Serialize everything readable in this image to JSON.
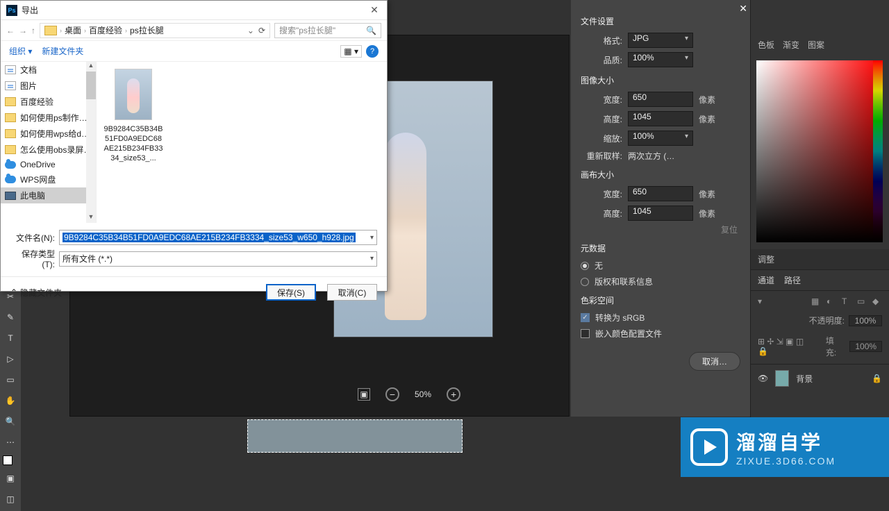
{
  "dialog": {
    "title": "导出",
    "breadcrumb": [
      "桌面",
      "百度经验",
      "ps拉长腿"
    ],
    "search_placeholder": "搜索\"ps拉长腿\"",
    "organize": "组织",
    "new_folder": "新建文件夹",
    "sidebar": [
      {
        "label": "文档",
        "icon": "doc"
      },
      {
        "label": "图片",
        "icon": "doc"
      },
      {
        "label": "百度经验",
        "icon": "folder"
      },
      {
        "label": "如何使用ps制作…",
        "icon": "folder"
      },
      {
        "label": "如何使用wps给d…",
        "icon": "folder"
      },
      {
        "label": "怎么使用obs录屏…",
        "icon": "folder"
      },
      {
        "label": "OneDrive",
        "icon": "cloud"
      },
      {
        "label": "WPS网盘",
        "icon": "cloud"
      },
      {
        "label": "此电脑",
        "icon": "pc",
        "selected": true
      }
    ],
    "file_thumb_name": "9B9284C35B34B51FD0A9EDC68AE215B234FB3334_size53_...",
    "filename_label": "文件名(N):",
    "filename_value": "9B9284C35B34B51FD0A9EDC68AE215B234FB3334_size53_w650_h928.jpg",
    "filetype_label": "保存类型(T):",
    "filetype_value": "所有文件 (*.*)",
    "hide_folders": "隐藏文件夹",
    "save_btn": "保存(S)",
    "cancel_btn": "取消(C)"
  },
  "export": {
    "file_settings": "文件设置",
    "format_label": "格式:",
    "format_value": "JPG",
    "quality_label": "品质:",
    "quality_value": "100%",
    "image_size": "图像大小",
    "width_label": "宽度:",
    "width_value": "650",
    "height_label": "高度:",
    "height_value": "1045",
    "scale_label": "缩放:",
    "scale_value": "100%",
    "resample_label": "重新取样:",
    "resample_value": "两次立方 (…",
    "unit": "像素",
    "canvas_size": "画布大小",
    "c_width": "650",
    "c_height": "1045",
    "reset": "复位",
    "metadata": "元数据",
    "meta_none": "无",
    "meta_copyright": "版权和联系信息",
    "colorspace": "色彩空间",
    "convert_srgb": "转换为 sRGB",
    "embed_profile": "嵌入颜色配置文件",
    "cancel": "取消…"
  },
  "zoom": {
    "percent": "50%"
  },
  "right": {
    "tabs_color": [
      "色板",
      "渐变",
      "图案"
    ],
    "adjust_hdr": "调整",
    "channel_tabs": [
      "通道",
      "路径"
    ],
    "opacity_lbl": "不透明度:",
    "opacity_val": "100%",
    "fill_lbl": "填充:",
    "fill_val": "100%",
    "layer_name": "背景"
  },
  "watermark": {
    "cn": "溜溜自学",
    "url": "ZIXUE.3D66.COM"
  }
}
